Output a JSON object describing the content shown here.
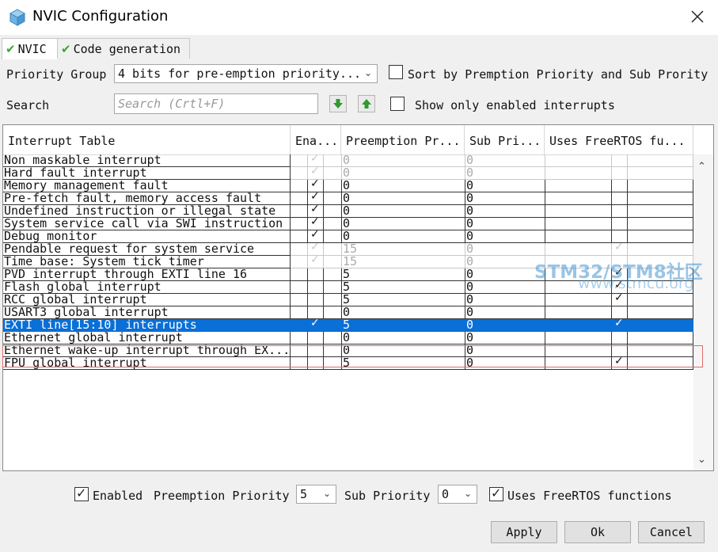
{
  "window": {
    "title": "NVIC Configuration"
  },
  "tabs": [
    {
      "label": "NVIC",
      "active": true
    },
    {
      "label": "Code generation",
      "active": false
    }
  ],
  "priority_group": {
    "label": "Priority Group",
    "value": "4 bits for pre-emption priority..."
  },
  "sort_option": {
    "label": "Sort by Premption Priority and Sub Prority",
    "checked": false
  },
  "search": {
    "label": "Search",
    "placeholder": "Search (Crtl+F)"
  },
  "show_enabled": {
    "label": "Show only enabled interrupts",
    "checked": false
  },
  "table": {
    "headers": [
      "Interrupt Table",
      "Ena...",
      "Preemption Pr...",
      "Sub Pri...",
      "Uses FreeRTOS fu..."
    ],
    "rows": [
      {
        "name": "Non maskable interrupt",
        "enabled": true,
        "preemption": "0",
        "sub": "0",
        "freertos": false,
        "disabled": true
      },
      {
        "name": "Hard fault interrupt",
        "enabled": true,
        "preemption": "0",
        "sub": "0",
        "freertos": false,
        "disabled": true
      },
      {
        "name": "Memory management fault",
        "enabled": true,
        "preemption": "0",
        "sub": "0",
        "freertos": false,
        "disabled": false
      },
      {
        "name": "Pre-fetch fault, memory access fault",
        "enabled": true,
        "preemption": "0",
        "sub": "0",
        "freertos": false,
        "disabled": false
      },
      {
        "name": "Undefined instruction or illegal state",
        "enabled": true,
        "preemption": "0",
        "sub": "0",
        "freertos": false,
        "disabled": false
      },
      {
        "name": "System service call via SWI instruction",
        "enabled": true,
        "preemption": "0",
        "sub": "0",
        "freertos": false,
        "disabled": false
      },
      {
        "name": "Debug monitor",
        "enabled": true,
        "preemption": "0",
        "sub": "0",
        "freertos": false,
        "disabled": false
      },
      {
        "name": "Pendable request for system service",
        "enabled": true,
        "preemption": "15",
        "sub": "0",
        "freertos": true,
        "disabled": true
      },
      {
        "name": "Time base: System tick timer",
        "enabled": true,
        "preemption": "15",
        "sub": "0",
        "freertos": false,
        "disabled": true
      },
      {
        "name": "PVD interrupt through EXTI line 16",
        "enabled": false,
        "preemption": "5",
        "sub": "0",
        "freertos": true,
        "disabled": false
      },
      {
        "name": "Flash global interrupt",
        "enabled": false,
        "preemption": "5",
        "sub": "0",
        "freertos": true,
        "disabled": false
      },
      {
        "name": "RCC global interrupt",
        "enabled": false,
        "preemption": "5",
        "sub": "0",
        "freertos": true,
        "disabled": false
      },
      {
        "name": "USART3 global interrupt",
        "enabled": false,
        "preemption": "0",
        "sub": "0",
        "freertos": false,
        "disabled": false
      },
      {
        "name": "EXTI line[15:10] interrupts",
        "enabled": true,
        "preemption": "5",
        "sub": "0",
        "freertos": true,
        "disabled": false,
        "selected": true
      },
      {
        "name": "Ethernet global interrupt",
        "enabled": false,
        "preemption": "0",
        "sub": "0",
        "freertos": false,
        "disabled": false
      },
      {
        "name": "Ethernet wake-up interrupt through EX...",
        "enabled": false,
        "preemption": "0",
        "sub": "0",
        "freertos": false,
        "disabled": false
      },
      {
        "name": "FPU global interrupt",
        "enabled": false,
        "preemption": "5",
        "sub": "0",
        "freertos": true,
        "disabled": false
      }
    ]
  },
  "watermark": {
    "line1": "STM32/STM8社区",
    "line2": "www.stmcu.org"
  },
  "detail": {
    "enabled_label": "Enabled",
    "enabled_checked": true,
    "preemption_label": "Preemption Priority",
    "preemption_value": "5",
    "sub_label": "Sub Priority",
    "sub_value": "0",
    "freertos_label": "Uses FreeRTOS functions",
    "freertos_checked": true
  },
  "buttons": {
    "apply": "Apply",
    "ok": "Ok",
    "cancel": "Cancel"
  },
  "colors": {
    "selection": "#0a6fd6",
    "tab_check": "#3aa535",
    "arrow_green": "#2e9b2e"
  }
}
